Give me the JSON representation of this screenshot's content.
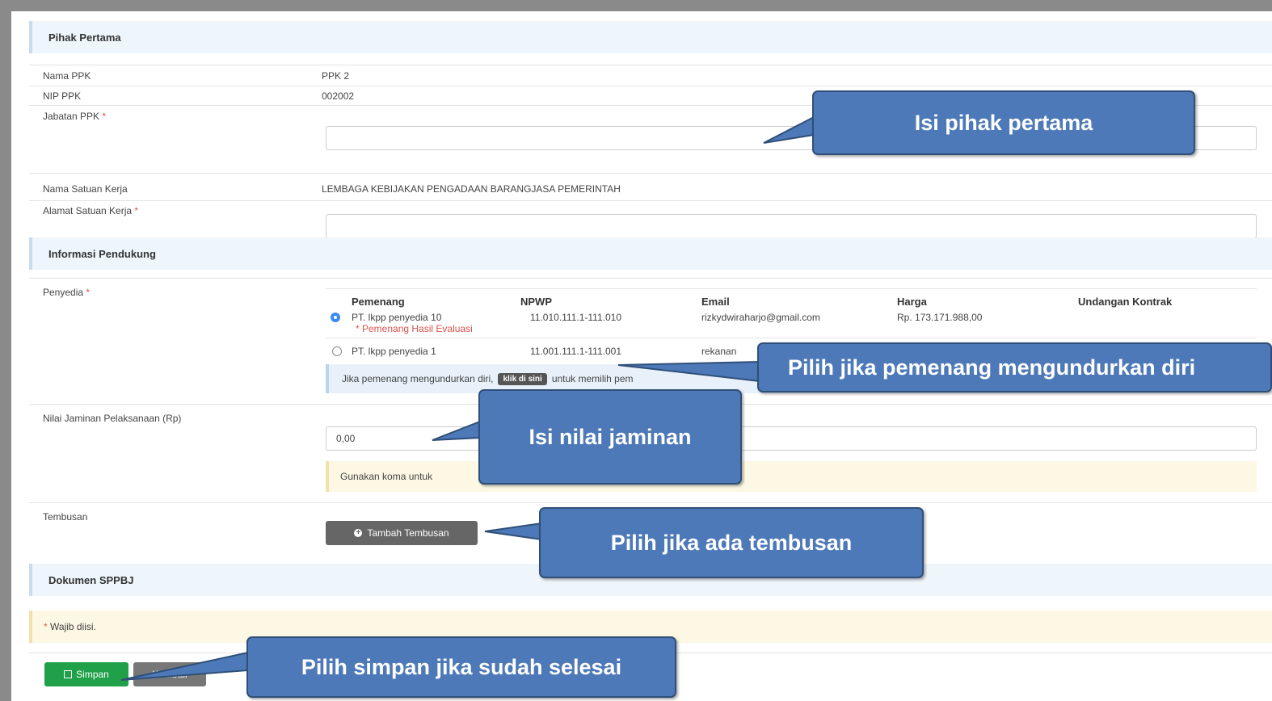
{
  "pihak_pertama": {
    "title": "Pihak Pertama",
    "nama_ppk_label": "Nama PPK",
    "nama_ppk_value": "PPK 2",
    "nip_ppk_label": "NIP PPK",
    "nip_ppk_value": "002002",
    "jabatan_ppk_label": "Jabatan PPK",
    "jabatan_ppk_value": "",
    "nama_satker_label": "Nama Satuan Kerja",
    "nama_satker_value": "LEMBAGA KEBIJAKAN PENGADAAN BARANGJASA PEMERINTAH",
    "alamat_satker_label": "Alamat Satuan Kerja",
    "alamat_satker_value": ""
  },
  "informasi_pendukung": {
    "title": "Informasi Pendukung",
    "penyedia_label": "Penyedia",
    "columns": [
      "Pemenang",
      "NPWP",
      "Email",
      "Harga",
      "Undangan Kontrak"
    ],
    "rows": [
      {
        "name": "PT. lkpp penyedia 10",
        "note": "* Pemenang Hasil Evaluasi",
        "npwp": "11.010.111.1-111.010",
        "email": "rizkydwiraharjo@gmail.com",
        "harga": "Rp. 173.171.988,00",
        "selected": true
      },
      {
        "name": "PT. lkpp penyedia 1",
        "note": "",
        "npwp": "11.001.111.1-111.001",
        "email": "rekanan",
        "harga": "",
        "selected": false
      }
    ],
    "mundur_text": "Jika pemenang mengundurkan diri,",
    "mundur_link": "klik di sini",
    "mundur_text_after": "untuk memilih pem",
    "jaminan_label": "Nilai Jaminan Pelaksanaan (Rp)",
    "jaminan_value": "0,00",
    "jaminan_hint": "Gunakan koma untuk",
    "tembusan_label": "Tembusan",
    "tambah_tembusan": "Tambah Tembusan"
  },
  "dokumen": {
    "title": "Dokumen SPPBJ",
    "wajib": "Wajib diisi.",
    "simpan": "Simpan",
    "kembali": "Kembali"
  },
  "callouts": {
    "isi_pihak_pertama": "Isi pihak pertama",
    "pilih_mundur": "Pilih jika pemenang mengundurkan diri",
    "isi_nilai_jaminan": "Isi nilai jaminan",
    "pilih_tembusan": "Pilih jika ada tembusan",
    "pilih_simpan": "Pilih simpan jika sudah selesai"
  },
  "colors": {
    "section_bg": "#eef5fb",
    "callout_bg": "#4d79b8",
    "simpan_green": "#1fa049",
    "required_red": "#d9534f"
  }
}
